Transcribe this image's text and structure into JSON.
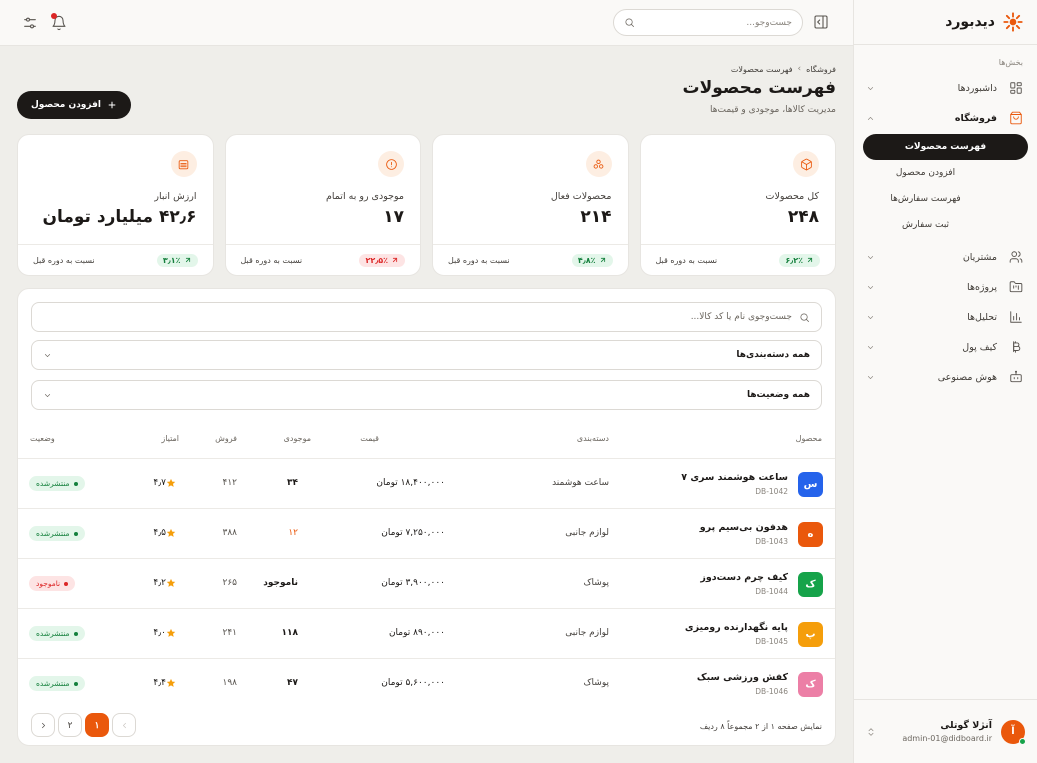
{
  "brand": {
    "name": "دیدبورد"
  },
  "sidebar": {
    "section_label": "بخش‌ها",
    "items": [
      {
        "label": "داشبوردها",
        "icon": "dashboard-grid-icon"
      },
      {
        "label": "فروشگاه",
        "icon": "shopping-bag-icon",
        "active": true,
        "children": [
          {
            "label": "فهرست محصولات",
            "current": true
          },
          {
            "label": "افزودن محصول"
          },
          {
            "label": "فهرست سفارش‌ها"
          },
          {
            "label": "ثبت سفارش"
          }
        ]
      },
      {
        "label": "مشتریان",
        "icon": "users-icon"
      },
      {
        "label": "پروژه‌ها",
        "icon": "folder-kanban-icon"
      },
      {
        "label": "تحلیل‌ها",
        "icon": "bar-chart-icon"
      },
      {
        "label": "کیف پول",
        "icon": "bitcoin-icon"
      },
      {
        "label": "هوش مصنوعی",
        "icon": "bot-icon"
      }
    ],
    "user": {
      "initial": "آ",
      "name": "آنژلا گوتلی",
      "email": "admin-01@didboard.ir"
    }
  },
  "topbar": {
    "search_placeholder": "جست‌وجو..."
  },
  "page": {
    "breadcrumb": [
      "فروشگاه",
      "فهرست محصولات"
    ],
    "title": "فهرست محصولات",
    "subtitle": "مدیریت کالاها، موجودی و قیمت‌ها",
    "add_button": "افزودن محصول"
  },
  "stats": [
    {
      "label": "کل محصولات",
      "value": "۲۴۸",
      "delta": "۶٫۲٪",
      "trend": "up",
      "foot": "نسبت به دوره قبل",
      "icon": "box-icon"
    },
    {
      "label": "محصولات فعال",
      "value": "۲۱۴",
      "delta": "۴٫۸٪",
      "trend": "up",
      "foot": "نسبت به دوره قبل",
      "icon": "boxes-icon"
    },
    {
      "label": "موجودی رو به اتمام",
      "value": "۱۷",
      "delta": "۲۲٫۵٪",
      "trend": "down",
      "foot": "نسبت به دوره قبل",
      "icon": "alert-circle-icon"
    },
    {
      "label": "ارزش انبار",
      "value": "۴۲٫۶ میلیارد تومان",
      "delta": "۳٫۱٪",
      "trend": "up",
      "foot": "نسبت به دوره قبل",
      "icon": "warehouse-icon"
    }
  ],
  "filters": {
    "search_placeholder": "جست‌وجوی نام یا کد کالا...",
    "category": "همه دسته‌بندی‌ها",
    "status": "همه وضعیت‌ها"
  },
  "table": {
    "headers": {
      "product": "محصول",
      "category": "دسته‌بندی",
      "price": "قیمت",
      "stock": "موجودی",
      "sales": "فروش",
      "rating": "امتیاز",
      "status": "وضعیت"
    },
    "rows": [
      {
        "initial": "س",
        "color": "#2563eb",
        "name": "ساعت هوشمند سری ۷",
        "sku": "DB-1042",
        "category": "ساعت هوشمند",
        "price": "۱۸,۴۰۰,۰۰۰ تومان",
        "stock": "۳۴",
        "stock_low": false,
        "sales": "۴۱۲",
        "rating": "۴٫۷",
        "status": "منتشرشده",
        "status_type": "ok"
      },
      {
        "initial": "ه",
        "color": "#ea580c",
        "name": "هدفون بی‌سیم پرو",
        "sku": "DB-1043",
        "category": "لوازم جانبی",
        "price": "۷,۲۵۰,۰۰۰ تومان",
        "stock": "۱۲",
        "stock_low": true,
        "sales": "۳۸۸",
        "rating": "۴٫۵",
        "status": "منتشرشده",
        "status_type": "ok"
      },
      {
        "initial": "ک",
        "color": "#16a34a",
        "name": "کیف چرم دست‌دوز",
        "sku": "DB-1044",
        "category": "پوشاک",
        "price": "۳,۹۰۰,۰۰۰ تومان",
        "stock": "ناموجود",
        "stock_low": false,
        "sales": "۲۶۵",
        "rating": "۴٫۲",
        "status": "ناموجود",
        "status_type": "no"
      },
      {
        "initial": "پ",
        "color": "#f59e0b",
        "name": "پایه نگهدارنده رومیزی",
        "sku": "DB-1045",
        "category": "لوازم جانبی",
        "price": "۸۹۰,۰۰۰ تومان",
        "stock": "۱۱۸",
        "stock_low": false,
        "sales": "۲۴۱",
        "rating": "۴٫۰",
        "status": "منتشرشده",
        "status_type": "ok"
      },
      {
        "initial": "ک",
        "color": "#ec7fa6",
        "name": "کفش ورزشی سبک",
        "sku": "DB-1046",
        "category": "پوشاک",
        "price": "۵,۶۰۰,۰۰۰ تومان",
        "stock": "۴۷",
        "stock_low": false,
        "sales": "۱۹۸",
        "rating": "۴٫۴",
        "status": "منتشرشده",
        "status_type": "ok"
      }
    ]
  },
  "pagination": {
    "info": "نمایش صفحه ۱ از ۲ مجموعاً ۸ ردیف",
    "pages": [
      "۱",
      "۲"
    ],
    "current": "۱"
  }
}
